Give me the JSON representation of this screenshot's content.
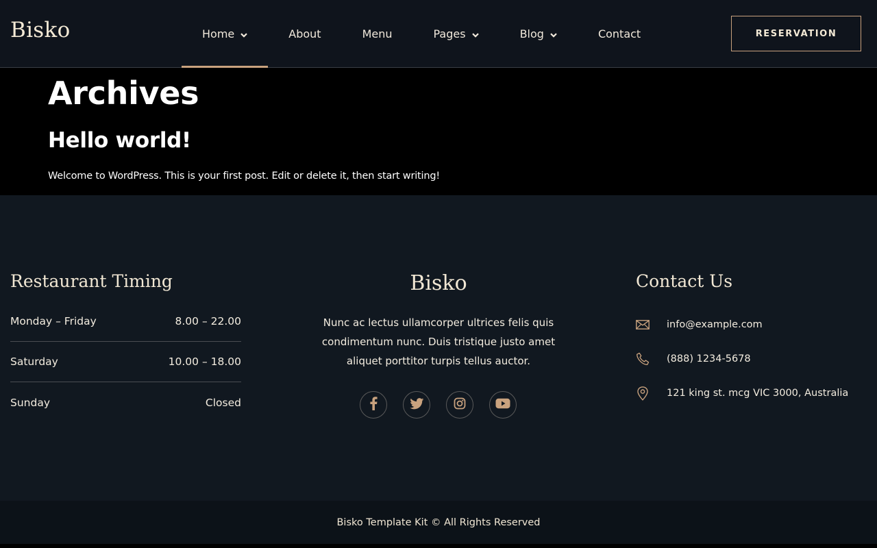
{
  "header": {
    "logo": "Bisko",
    "nav": [
      {
        "label": "Home",
        "dropdown": true,
        "active": true
      },
      {
        "label": "About",
        "dropdown": false
      },
      {
        "label": "Menu",
        "dropdown": false
      },
      {
        "label": "Pages",
        "dropdown": true
      },
      {
        "label": "Blog",
        "dropdown": true
      },
      {
        "label": "Contact",
        "dropdown": false
      }
    ],
    "reservation_label": "RESERVATION"
  },
  "main": {
    "archive_title": "Archives",
    "post_title": "Hello world!",
    "post_excerpt": "Welcome to WordPress. This is your first post. Edit or delete it, then start writing!"
  },
  "footer": {
    "timing": {
      "title": "Restaurant Timing",
      "rows": [
        {
          "day": "Monday – Friday",
          "hours": "8.00 – 22.00"
        },
        {
          "day": "Saturday",
          "hours": "10.00 – 18.00"
        },
        {
          "day": "Sunday",
          "hours": "Closed"
        }
      ]
    },
    "brand": {
      "title": "Bisko",
      "description": "Nunc ac lectus ullamcorper ultrices felis quis condimentum nunc. Duis tristique justo amet aliquet porttitor turpis tellus auctor.",
      "socials": [
        "facebook-icon",
        "twitter-icon",
        "instagram-icon",
        "youtube-icon"
      ]
    },
    "contact": {
      "title": "Contact Us",
      "email": "info@example.com",
      "phone": "(888) 1234-5678",
      "address": "121 king st. mcg VIC 3000, Australia"
    },
    "copyright": "Bisko Template Kit © All Rights Reserved"
  },
  "colors": {
    "accent": "#c9a27e",
    "header_bg": "#0f141c",
    "footer_bg": "#111820",
    "text_cream": "#f1e7d4"
  }
}
